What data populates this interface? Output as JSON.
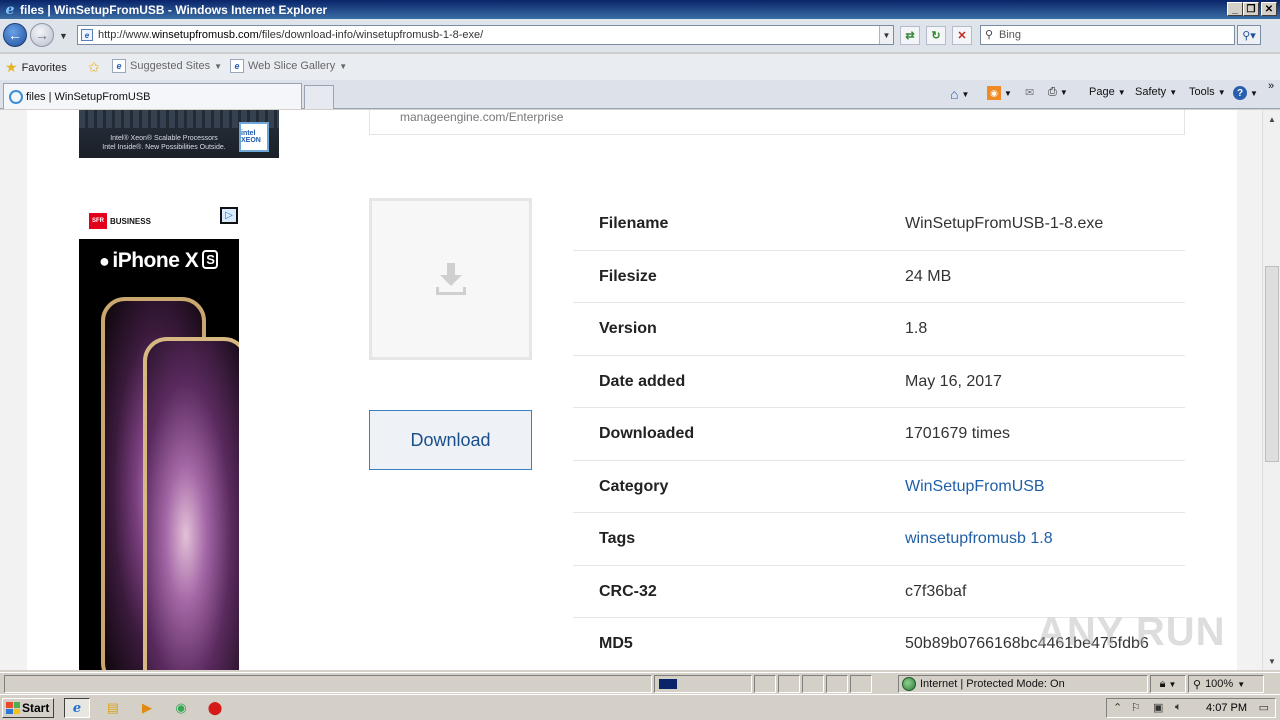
{
  "window": {
    "title": "files | WinSetupFromUSB - Windows Internet Explorer"
  },
  "address": {
    "url_prefix": "http://www.",
    "url_host": "winsetupfromusb.com",
    "url_path": "/files/download-info/winsetupfromusb-1-8-exe/",
    "search_placeholder": "Bing"
  },
  "favorites": {
    "label": "Favorites",
    "suggested": "Suggested Sites",
    "webslice": "Web Slice Gallery"
  },
  "tab": {
    "label": "files | WinSetupFromUSB"
  },
  "command_bar": {
    "page": "Page",
    "safety": "Safety",
    "tools": "Tools"
  },
  "page": {
    "top_ad": {
      "text": "Intel® Xeon® Scalable Processors\nIntel Inside®. New Possibilities Outside.",
      "badge": "intel XEON"
    },
    "top_box_text": "manageengine.com/Enterprise",
    "side_ad": {
      "brand": "iPhone X",
      "brand_suffix": "S",
      "sponsor": "BUSINESS",
      "sponsor_logo": "SFR"
    },
    "download_button": "Download",
    "info": [
      {
        "key": "Filename",
        "value": "WinSetupFromUSB-1-8.exe",
        "link": false
      },
      {
        "key": "Filesize",
        "value": "24 MB",
        "link": false
      },
      {
        "key": "Version",
        "value": "1.8",
        "link": false
      },
      {
        "key": "Date added",
        "value": "May 16, 2017",
        "link": false
      },
      {
        "key": "Downloaded",
        "value": "1701679 times",
        "link": false
      },
      {
        "key": "Category",
        "value": "WinSetupFromUSB",
        "link": true
      },
      {
        "key": "Tags",
        "value": "winsetupfromusb 1.8",
        "link": true
      },
      {
        "key": "CRC-32",
        "value": "c7f36baf",
        "link": false
      },
      {
        "key": "MD5",
        "value": "50b89b0766168bc4461be475fdb6",
        "link": false
      }
    ],
    "watermark": "ANY RUN"
  },
  "status": {
    "zone": "Internet | Protected Mode: On",
    "zoom": "100%"
  },
  "taskbar": {
    "start": "Start",
    "clock": "4:07 PM"
  },
  "colors": {
    "link": "#1f5fa8",
    "title_bar": "#0a246a",
    "download_border": "#3a7fc1"
  }
}
